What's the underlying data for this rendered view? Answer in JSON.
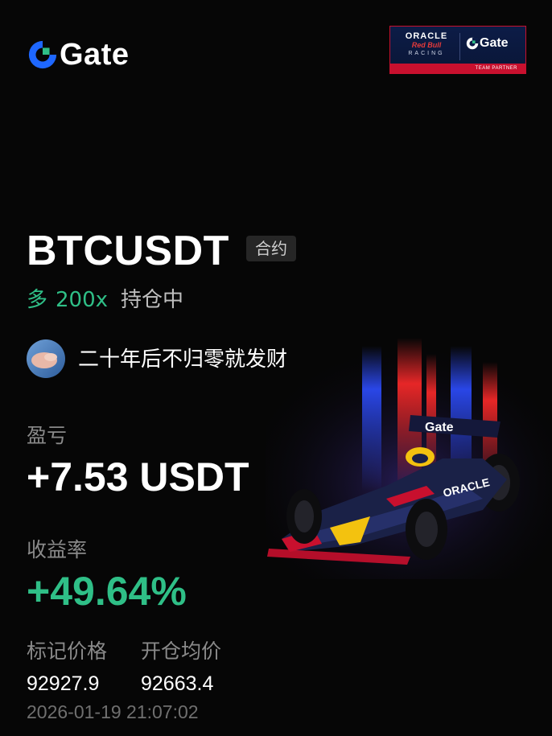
{
  "brand": {
    "name": "Gate",
    "accent_blue": "#1e67ff",
    "accent_green": "#2fbf87"
  },
  "partner_badge": {
    "oracle": "ORACLE",
    "redbull": "Red Bull",
    "racing": "RACING",
    "gate": "Gate",
    "footer": "TEAM PARTNER"
  },
  "position": {
    "pair": "BTCUSDT",
    "contract_tag": "合约",
    "direction": "多",
    "leverage": "200x",
    "status": "持仓中"
  },
  "user": {
    "nickname": "二十年后不归零就发财"
  },
  "pnl": {
    "label": "盈亏",
    "value": "+7.53 USDT"
  },
  "roi": {
    "label": "收益率",
    "value": "+49.64%"
  },
  "prices": {
    "mark_label": "标记价格",
    "mark_value": "92927.9",
    "entry_label": "开仓均价",
    "entry_value": "92663.4"
  },
  "timestamp": "2026-01-19 21:07:02",
  "icons": {
    "logo": "gate-logo-icon",
    "car": "f1-car-illustration"
  }
}
